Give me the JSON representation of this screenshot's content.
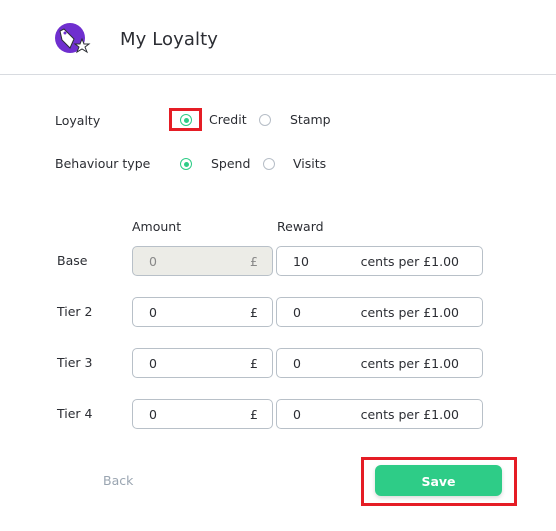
{
  "header": {
    "title": "My Loyalty",
    "logo_icon": "loyalty-tag-star-icon",
    "accent": "#6f2fcf"
  },
  "loyalty": {
    "label": "Loyalty",
    "options": [
      {
        "label": "Credit",
        "checked": true
      },
      {
        "label": "Stamp",
        "checked": false
      }
    ]
  },
  "behaviour": {
    "label": "Behaviour type",
    "options": [
      {
        "label": "Spend",
        "checked": true
      },
      {
        "label": "Visits",
        "checked": false
      }
    ]
  },
  "table": {
    "amount_header": "Amount",
    "reward_header": "Reward",
    "currency_symbol": "£",
    "reward_suffix": "cents per £1.00",
    "rows": [
      {
        "label": "Base",
        "amount": "0",
        "reward": "10",
        "amount_disabled": true
      },
      {
        "label": "Tier 2",
        "amount": "0",
        "reward": "0",
        "amount_disabled": false
      },
      {
        "label": "Tier 3",
        "amount": "0",
        "reward": "0",
        "amount_disabled": false
      },
      {
        "label": "Tier 4",
        "amount": "0",
        "reward": "0",
        "amount_disabled": false
      }
    ]
  },
  "footer": {
    "back_label": "Back",
    "save_label": "Save"
  },
  "colors": {
    "primary_green": "#2ecc87",
    "highlight_red": "#e51d25"
  }
}
